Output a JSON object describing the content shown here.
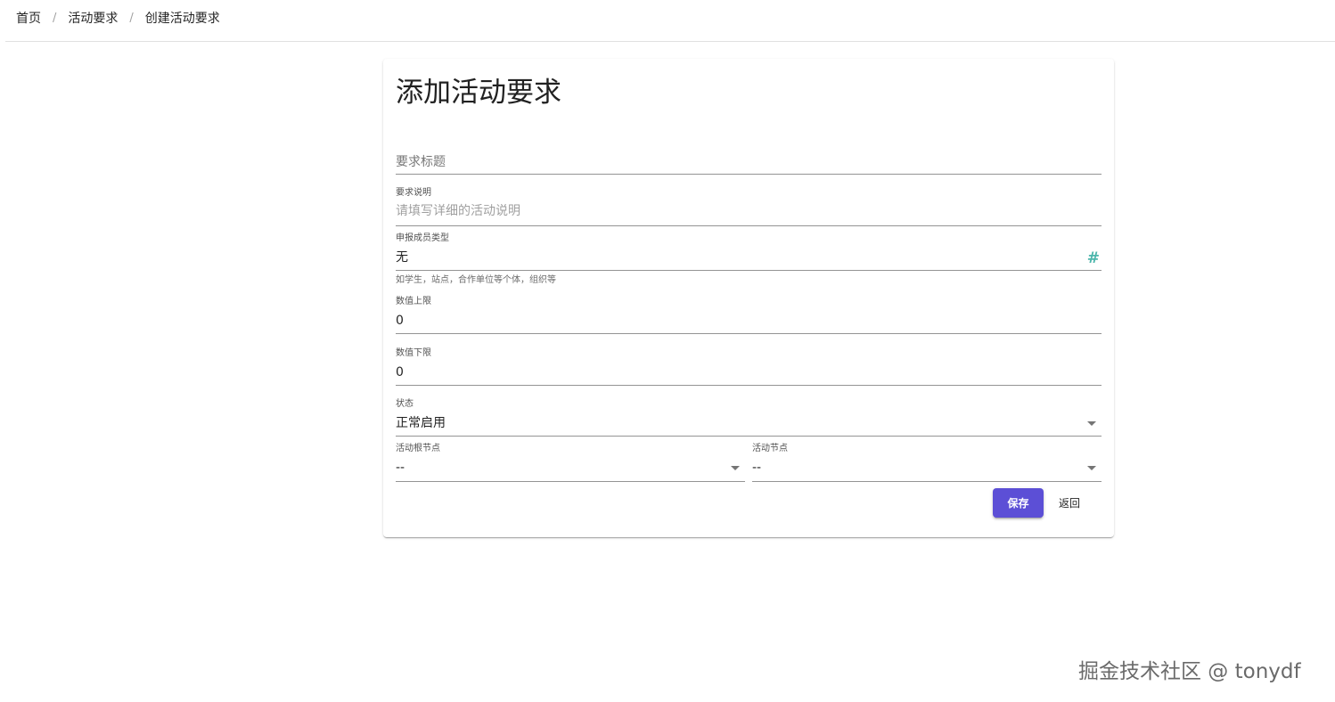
{
  "breadcrumb": {
    "items": [
      "首页",
      "活动要求",
      "创建活动要求"
    ],
    "separator": "/"
  },
  "form": {
    "title": "添加活动要求",
    "fields": {
      "req_title": {
        "label": "要求标题",
        "value": ""
      },
      "req_desc": {
        "label": "要求说明",
        "placeholder": "请填写详细的活动说明",
        "value": ""
      },
      "member_type": {
        "label": "申报成员类型",
        "value": "无",
        "hint": "如学生，站点，合作单位等个体，组织等",
        "icon": "hash-icon"
      },
      "upper_limit": {
        "label": "数值上限",
        "value": "0"
      },
      "lower_limit": {
        "label": "数值下限",
        "value": "0"
      },
      "status": {
        "label": "状态",
        "value": "正常启用"
      },
      "root_node": {
        "label": "活动根节点",
        "value": "--"
      },
      "node": {
        "label": "活动节点",
        "value": "--"
      }
    },
    "actions": {
      "save_label": "保存",
      "back_label": "返回"
    }
  },
  "watermark": "掘金技术社区 @ tonydf",
  "colors": {
    "primary": "#5c4fd6",
    "icon_teal": "#4db6ac"
  }
}
